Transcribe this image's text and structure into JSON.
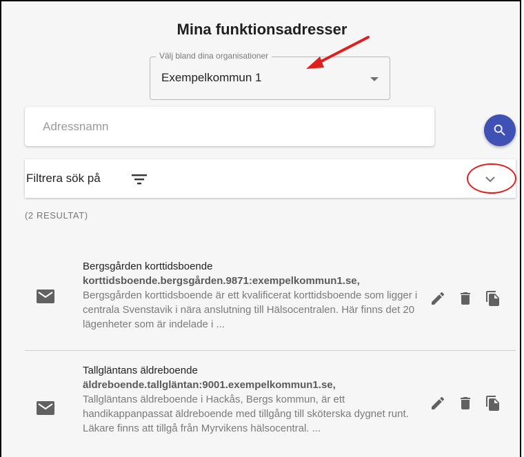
{
  "page": {
    "title": "Mina funktionsadresser"
  },
  "org_select": {
    "label": "Välj bland dina organisationer",
    "value": "Exempelkommun 1"
  },
  "search": {
    "placeholder": "Adressnamn",
    "value": ""
  },
  "filter": {
    "label": "Filtrera sök på"
  },
  "results": {
    "count_label": "(2 RESULTAT)",
    "items": [
      {
        "name": "Bergsgården korttidsboende",
        "address": "korttidsboende.bergsgården.9871:exempelkommun1.se,",
        "description": "Bergsgården korttidsboende är ett kvalificerat korttidsboende som ligger i centrala Svenstavik i nära anslutning till Hälsocentralen. Här finns det 20 lägenheter som är indelade i ..."
      },
      {
        "name": "Tallgläntans äldreboende",
        "address": "äldreboende.tallgläntan:9001.exempelkommun1.se,",
        "description": "Tallgläntans äldreboende i Hackås, Bergs kommun, är ett handikappanpassat äldreboende med tillgång till sköterska dygnet runt. Läkare finns att tillgå från Myrvikens hälsocentral. ..."
      }
    ]
  },
  "colors": {
    "accent": "#3f51b5",
    "annotation": "#e01e1e",
    "icon": "#616161"
  }
}
